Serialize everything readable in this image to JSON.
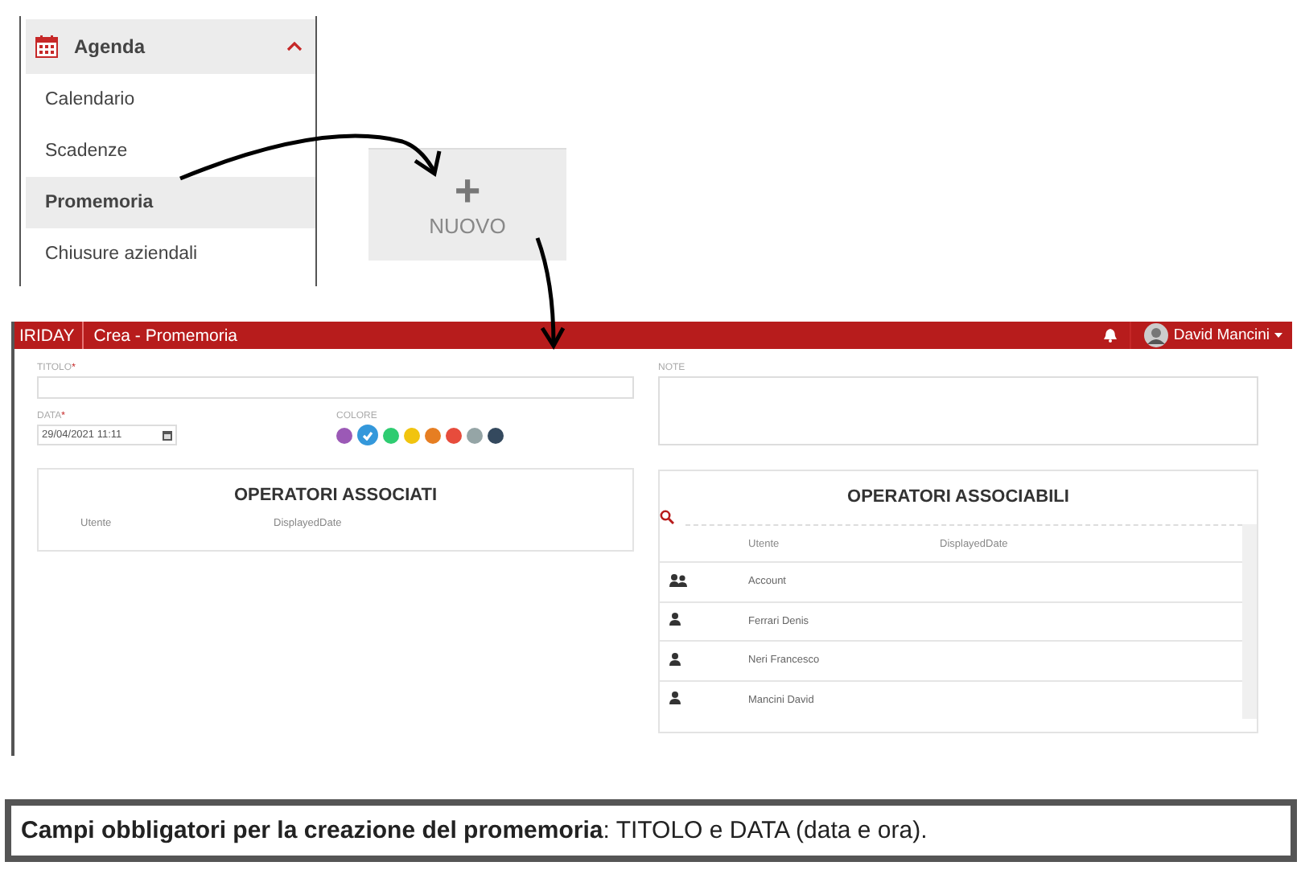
{
  "sidebar": {
    "header": {
      "label": "Agenda",
      "expanded": true
    },
    "items": [
      {
        "label": "Calendario",
        "selected": false
      },
      {
        "label": "Scadenze",
        "selected": false
      },
      {
        "label": "Promemoria",
        "selected": true
      },
      {
        "label": "Chiusure aziendali",
        "selected": false
      }
    ]
  },
  "nuovo_button": {
    "icon": "+",
    "label": "NUOVO"
  },
  "app": {
    "brand": "IRIDAY",
    "title": "Crea - Promemoria",
    "user": {
      "name": "David Mancini"
    }
  },
  "form": {
    "titolo": {
      "label": "TITOLO",
      "required_mark": "*"
    },
    "data": {
      "label": "DATA",
      "required_mark": "*",
      "value": "29/04/2021 11:11"
    },
    "colore": {
      "label": "COLORE",
      "swatches": [
        {
          "color": "#9b59b6",
          "selected": false
        },
        {
          "color": "#3498db",
          "selected": true
        },
        {
          "color": "#2ecc71",
          "selected": false
        },
        {
          "color": "#f1c40f",
          "selected": false
        },
        {
          "color": "#e67e22",
          "selected": false
        },
        {
          "color": "#e74c3c",
          "selected": false
        },
        {
          "color": "#95a5a6",
          "selected": false
        },
        {
          "color": "#34495e",
          "selected": false
        }
      ]
    },
    "note": {
      "label": "NOTE"
    }
  },
  "operatori_associati": {
    "title": "OPERATORI ASSOCIATI",
    "columns": [
      "Utente",
      "DisplayedDate"
    ]
  },
  "operatori_associabili": {
    "title": "OPERATORI ASSOCIABILI",
    "columns": [
      "Utente",
      "DisplayedDate"
    ],
    "rows": [
      {
        "kind": "group",
        "utente": "Account"
      },
      {
        "kind": "user",
        "utente": "Ferrari Denis"
      },
      {
        "kind": "user",
        "utente": "Neri Francesco"
      },
      {
        "kind": "user",
        "utente": "Mancini David"
      }
    ]
  },
  "caption": "**Campi obbligatori per la creazione del promemoria**: TITOLO e DATA (data e ora)."
}
